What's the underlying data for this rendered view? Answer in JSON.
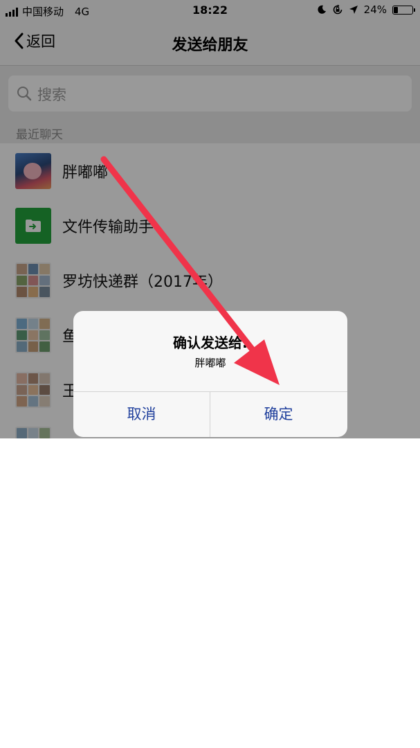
{
  "status_bar": {
    "carrier": "中国移动",
    "network": "4G",
    "time": "18:22",
    "battery": "24%",
    "battery_level": 0.24,
    "icons": [
      "signal-icon",
      "moon-icon",
      "rotation-lock-icon",
      "location-arrow-icon",
      "battery-icon"
    ]
  },
  "nav": {
    "back_label": "返回",
    "title": "发送给朋友"
  },
  "search": {
    "placeholder": "搜索"
  },
  "recent": {
    "header": "最近聊天",
    "items": [
      {
        "name": "胖嘟嘟"
      },
      {
        "name": "文件传输助手"
      },
      {
        "name": "罗坊快递群（2017年）"
      },
      {
        "name": "鱼"
      },
      {
        "name": "王"
      },
      {
        "name": ""
      }
    ]
  },
  "dialog": {
    "title": "确认发送给:",
    "message": "胖嘟嘟",
    "cancel_label": "取消",
    "confirm_label": "确定"
  },
  "colors": {
    "dialog_button": "#1f3f9c",
    "arrow": "#f0344a",
    "file_icon_bg": "#23a43c"
  }
}
